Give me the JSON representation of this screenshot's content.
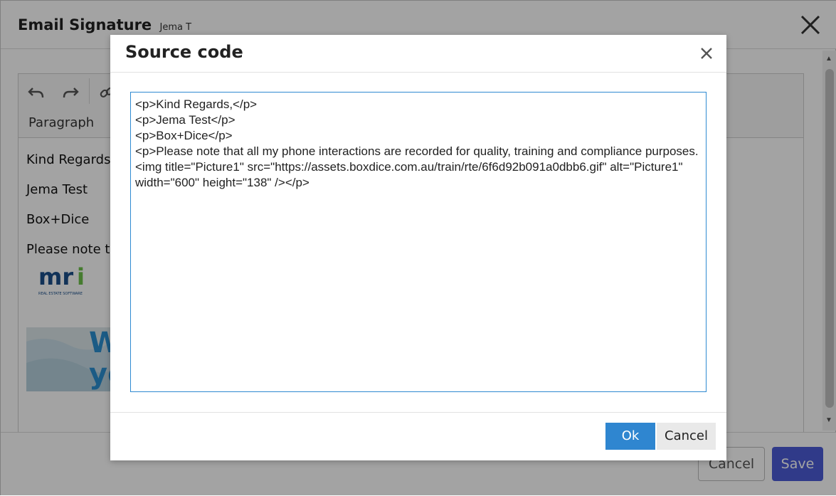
{
  "window": {
    "title": "Email Signature",
    "subtitle": "Jema T",
    "close_icon": "close-icon"
  },
  "toolbar": {
    "undo_icon": "undo-icon",
    "redo_icon": "redo-icon",
    "link_icon": "link-icon",
    "block_format": "Paragraph"
  },
  "editor_content": {
    "lines": [
      "Kind Regards",
      "Jema Test",
      "Box+Dice",
      "Please note t"
    ],
    "logo_text": "mri",
    "logo_caption": "REAL ESTATE SOFTWARE",
    "banner_text": "W\nyc"
  },
  "footer": {
    "cancel_label": "Cancel",
    "save_label": "Save"
  },
  "modal": {
    "title": "Source code",
    "close_icon": "close-icon",
    "source_code": "<p>Kind Regards,</p>\n<p>Jema Test</p>\n<p>Box+Dice</p>\n<p>Please note that all my phone interactions are recorded for quality, training and compliance purposes.<img title=\"Picture1\" src=\"https://assets.boxdice.com.au/train/rte/6f6d92b091a0dbb6.gif\" alt=\"Picture1\" width=\"600\" height=\"138\" /></p>",
    "ok_label": "Ok",
    "cancel_label": "Cancel"
  },
  "colors": {
    "accent": "#2f86d0",
    "save_button": "#4b5cd6",
    "overlay": "rgba(0,0,0,0.36)"
  }
}
